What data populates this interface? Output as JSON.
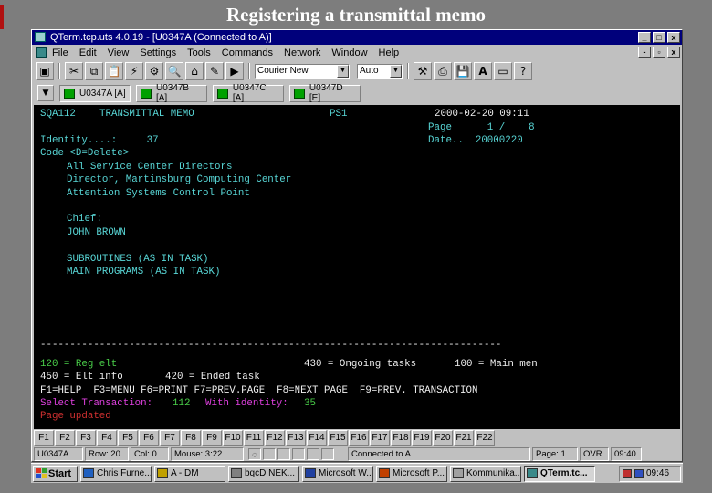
{
  "banner": "Registering a transmittal memo",
  "window": {
    "title": "QTerm.tcp.uts 4.0.19 - [U0347A (Connected to A)]",
    "controls": [
      "_",
      "□",
      "x"
    ],
    "mdi_controls": [
      "-",
      "▫",
      "x"
    ]
  },
  "menu": [
    "File",
    "Edit",
    "View",
    "Settings",
    "Tools",
    "Commands",
    "Network",
    "Window",
    "Help"
  ],
  "toolbar": {
    "font_value": "Courier New",
    "size_value": "Auto"
  },
  "sessions": [
    {
      "label": "U0347A [A]",
      "active": true
    },
    {
      "label": "U0347B [A]",
      "active": false
    },
    {
      "label": "U0347C [A]",
      "active": false
    },
    {
      "label": "U0347D [E]",
      "active": false
    }
  ],
  "terminal": {
    "screen_id": "SQA112",
    "screen_title": "TRANSMITTAL MEMO",
    "ps": "PS1",
    "datetime": "2000-02-20 09:11",
    "page_line": "Page      1 /    8",
    "date_line": "Date..  20000220",
    "identity_line": "Identity....:     37",
    "code_line": "Code <D=Delete>",
    "recipients": [
      "All Service Center Directors",
      "Director, Martinsburg Computing Center",
      "Attention Systems Control Point"
    ],
    "chief_label": "Chief:",
    "chief_name": "JOHN BROWN",
    "items": [
      "SUBROUTINES (AS IN TASK)",
      "MAIN PROGRAMS (AS IN TASK)"
    ],
    "divider": "------------------------------------------------------------------------------",
    "legend_1a": "120 = Reg elt",
    "legend_1b": "430 = Ongoing tasks",
    "legend_1c": "100 = Main men",
    "legend_2a": "450 = Elt info",
    "legend_2b": "420 = Ended task",
    "fn_line": "F1=HELP  F3=MENU F6=PRINT F7=PREV.PAGE  F8=NEXT PAGE  F9=PREV. TRANSACTION",
    "select_label": "Select Transaction:",
    "select_value": "112",
    "identity_label": "With identity:",
    "identity_value": "35",
    "status_msg": "Page updated"
  },
  "fkeys": [
    "F1",
    "F2",
    "F3",
    "F4",
    "F5",
    "F6",
    "F7",
    "F8",
    "F9",
    "F10",
    "F11",
    "F12",
    "F13",
    "F14",
    "F15",
    "F16",
    "F17",
    "F18",
    "F19",
    "F20",
    "F21",
    "F22"
  ],
  "statusbar": {
    "session": "U0347A",
    "row": "Row: 20",
    "col": "Col: 0",
    "mouse": "Mouse: 3:22",
    "connection": "Connected to A",
    "page": "Page: 1",
    "mode": "OVR",
    "time": "09:40"
  },
  "taskbar": {
    "start": "Start",
    "tasks": [
      {
        "label": "Chris Furne...",
        "active": false,
        "color": "#2060c0"
      },
      {
        "label": "A - DM",
        "active": false,
        "color": "#c0a000"
      },
      {
        "label": "bqcD NEK...",
        "active": false,
        "color": "#808080"
      },
      {
        "label": "Microsoft W...",
        "active": false,
        "color": "#2040a0"
      },
      {
        "label": "Microsoft P...",
        "active": false,
        "color": "#c04000"
      },
      {
        "label": "Kommunika...",
        "active": false,
        "color": "#a0a0a0"
      },
      {
        "label": "QTerm.tc...",
        "active": true,
        "color": "#3a8a8a"
      }
    ],
    "clock": "09:46"
  }
}
